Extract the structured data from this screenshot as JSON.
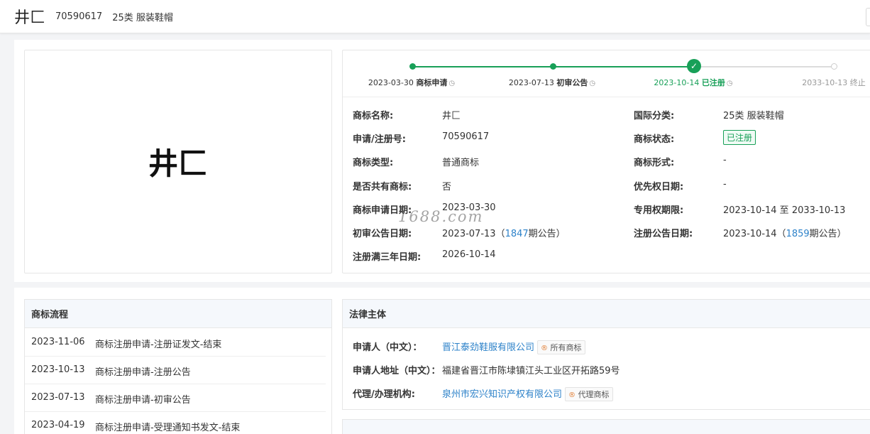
{
  "header": {
    "trademark_name": "井匚",
    "reg_number": "70590617",
    "class": "25类 服装鞋帽"
  },
  "logo": {
    "text": "井匚"
  },
  "timeline": [
    {
      "date": "2023-03-30",
      "label": "商标申请",
      "state": "done"
    },
    {
      "date": "2023-07-13",
      "label": "初审公告",
      "state": "done"
    },
    {
      "date": "2023-10-14",
      "label": "已注册",
      "state": "current"
    },
    {
      "date": "2033-10-13",
      "label": "终止",
      "state": "pending"
    }
  ],
  "info": {
    "name_label": "商标名称:",
    "name": "井匚",
    "regno_label": "申请/注册号:",
    "regno": "70590617",
    "type_label": "商标类型:",
    "type": "普通商标",
    "shared_label": "是否共有商标:",
    "shared": "否",
    "apply_date_label": "商标申请日期:",
    "apply_date": "2023-03-30",
    "prelim_label": "初审公告日期:",
    "prelim_date": "2023-07-13（",
    "prelim_issue": "1847",
    "prelim_suffix": "期公告）",
    "three_year_label": "注册满三年日期:",
    "three_year": "2026-10-14",
    "intl_class_label": "国际分类:",
    "intl_class": "25类 服装鞋帽",
    "status_label": "商标状态:",
    "status": "已注册",
    "form_label": "商标形式:",
    "form": "-",
    "priority_label": "优先权日期:",
    "priority": "-",
    "exclusive_label": "专用权期限:",
    "exclusive": "2023-10-14 至 2033-10-13",
    "reg_pub_label": "注册公告日期:",
    "reg_pub_date": "2023-10-14（",
    "reg_pub_issue": "1859",
    "reg_pub_suffix": "期公告）"
  },
  "watermark": "1688.com",
  "flow": {
    "title": "商标流程",
    "rows": [
      {
        "date": "2023-11-06",
        "text": "商标注册申请-注册证发文-结束"
      },
      {
        "date": "2023-10-13",
        "text": "商标注册申请-注册公告"
      },
      {
        "date": "2023-07-13",
        "text": "商标注册申请-初审公告"
      },
      {
        "date": "2023-04-19",
        "text": "商标注册申请-受理通知书发文-结束"
      }
    ]
  },
  "legal": {
    "title": "法律主体",
    "applicant_label": "申请人（中文）：",
    "applicant": "晋江泰劲鞋服有限公司",
    "applicant_tag": "所有商标",
    "address_label": "申请人地址（中文）：",
    "address": "福建省晋江市陈埭镇江头工业区开拓路59号",
    "agent_label": "代理/办理机构:",
    "agent": "泉州市宏兴知识产权有限公司",
    "agent_tag": "代理商标"
  },
  "colors": {
    "accent_green": "#18a058",
    "link_blue": "#2d82c9"
  }
}
